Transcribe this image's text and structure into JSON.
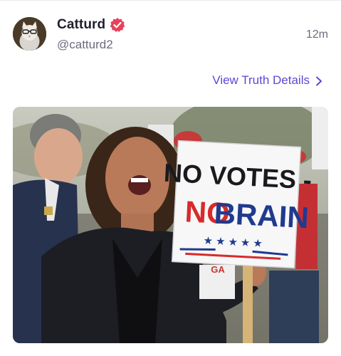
{
  "post": {
    "display_name": "Catturd",
    "handle": "@catturd2",
    "timestamp": "12m",
    "verified_icon": "verified-badge-icon",
    "verified_color": "#e8415a"
  },
  "actions": {
    "view_details_label": "View Truth Details",
    "view_details_icon": "chevron-right-icon",
    "accent": "#5b48d6"
  },
  "media": {
    "sign_line1": "NO VOTES -",
    "sign_line2_red": "NO",
    "sign_line2_blue": "BRAIN",
    "background_sign_fragment": "GA"
  }
}
